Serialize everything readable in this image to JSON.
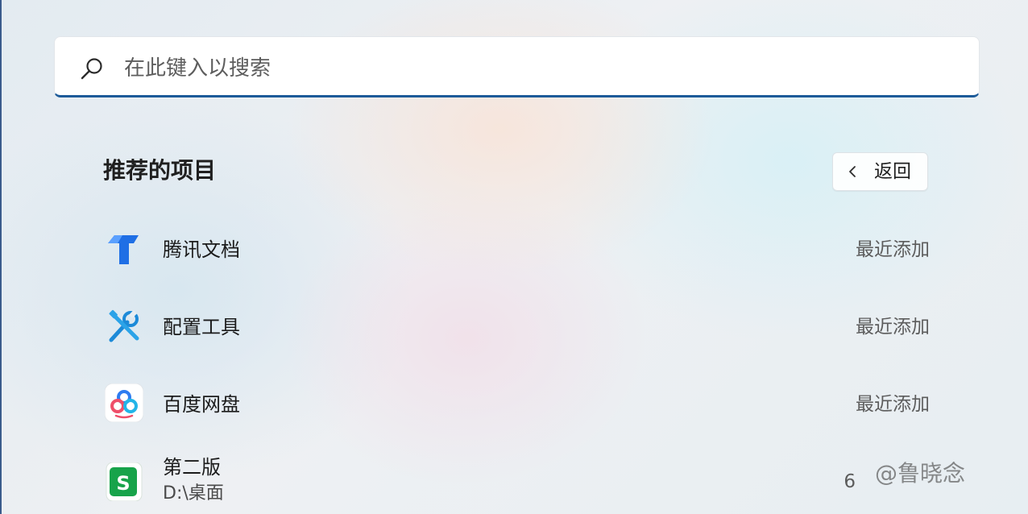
{
  "search": {
    "placeholder": "在此键入以搜索"
  },
  "recommended": {
    "title": "推荐的项目",
    "back_label": "返回",
    "items": [
      {
        "name": "腾讯文档",
        "status": "最近添加",
        "icon": "tencent-docs-icon",
        "color": "#1f6fe5"
      },
      {
        "name": "配置工具",
        "status": "最近添加",
        "icon": "tools-icon",
        "color": "#1c8ad8"
      },
      {
        "name": "百度网盘",
        "status": "最近添加",
        "icon": "baidu-netdisk-icon",
        "color": "#2e7cf0"
      },
      {
        "name": "第二版",
        "subtitle": "D:\\桌面",
        "status": "6",
        "icon": "spreadsheet-icon",
        "color": "#17a34a"
      }
    ]
  },
  "watermark": "@鲁晓念",
  "colors": {
    "accent": "#1d5b99"
  }
}
